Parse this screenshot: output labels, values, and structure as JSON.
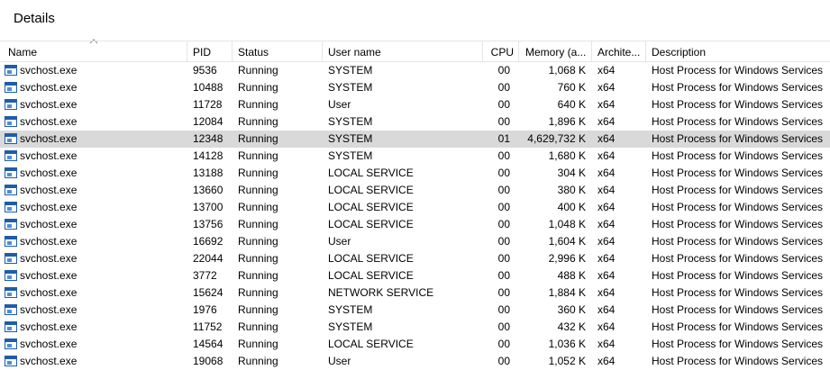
{
  "panel": {
    "title": "Details"
  },
  "columns": {
    "name": "Name",
    "pid": "PID",
    "status": "Status",
    "user": "User name",
    "cpu": "CPU",
    "memory": "Memory (a...",
    "arch": "Archite...",
    "description": "Description"
  },
  "sort": {
    "column": "Name",
    "direction": "ascending"
  },
  "icon": "process-window-icon",
  "selected_row_index": 4,
  "rows": [
    {
      "name": "svchost.exe",
      "pid": "9536",
      "status": "Running",
      "user": "SYSTEM",
      "cpu": "00",
      "memory": "1,068 K",
      "arch": "x64",
      "description": "Host Process for Windows Services"
    },
    {
      "name": "svchost.exe",
      "pid": "10488",
      "status": "Running",
      "user": "SYSTEM",
      "cpu": "00",
      "memory": "760 K",
      "arch": "x64",
      "description": "Host Process for Windows Services"
    },
    {
      "name": "svchost.exe",
      "pid": "11728",
      "status": "Running",
      "user": "User",
      "cpu": "00",
      "memory": "640 K",
      "arch": "x64",
      "description": "Host Process for Windows Services"
    },
    {
      "name": "svchost.exe",
      "pid": "12084",
      "status": "Running",
      "user": "SYSTEM",
      "cpu": "00",
      "memory": "1,896 K",
      "arch": "x64",
      "description": "Host Process for Windows Services"
    },
    {
      "name": "svchost.exe",
      "pid": "12348",
      "status": "Running",
      "user": "SYSTEM",
      "cpu": "01",
      "memory": "4,629,732 K",
      "arch": "x64",
      "description": "Host Process for Windows Services"
    },
    {
      "name": "svchost.exe",
      "pid": "14128",
      "status": "Running",
      "user": "SYSTEM",
      "cpu": "00",
      "memory": "1,680 K",
      "arch": "x64",
      "description": "Host Process for Windows Services"
    },
    {
      "name": "svchost.exe",
      "pid": "13188",
      "status": "Running",
      "user": "LOCAL SERVICE",
      "cpu": "00",
      "memory": "304 K",
      "arch": "x64",
      "description": "Host Process for Windows Services"
    },
    {
      "name": "svchost.exe",
      "pid": "13660",
      "status": "Running",
      "user": "LOCAL SERVICE",
      "cpu": "00",
      "memory": "380 K",
      "arch": "x64",
      "description": "Host Process for Windows Services"
    },
    {
      "name": "svchost.exe",
      "pid": "13700",
      "status": "Running",
      "user": "LOCAL SERVICE",
      "cpu": "00",
      "memory": "400 K",
      "arch": "x64",
      "description": "Host Process for Windows Services"
    },
    {
      "name": "svchost.exe",
      "pid": "13756",
      "status": "Running",
      "user": "LOCAL SERVICE",
      "cpu": "00",
      "memory": "1,048 K",
      "arch": "x64",
      "description": "Host Process for Windows Services"
    },
    {
      "name": "svchost.exe",
      "pid": "16692",
      "status": "Running",
      "user": "User",
      "cpu": "00",
      "memory": "1,604 K",
      "arch": "x64",
      "description": "Host Process for Windows Services"
    },
    {
      "name": "svchost.exe",
      "pid": "22044",
      "status": "Running",
      "user": "LOCAL SERVICE",
      "cpu": "00",
      "memory": "2,996 K",
      "arch": "x64",
      "description": "Host Process for Windows Services"
    },
    {
      "name": "svchost.exe",
      "pid": "3772",
      "status": "Running",
      "user": "LOCAL SERVICE",
      "cpu": "00",
      "memory": "488 K",
      "arch": "x64",
      "description": "Host Process for Windows Services"
    },
    {
      "name": "svchost.exe",
      "pid": "15624",
      "status": "Running",
      "user": "NETWORK SERVICE",
      "cpu": "00",
      "memory": "1,884 K",
      "arch": "x64",
      "description": "Host Process for Windows Services"
    },
    {
      "name": "svchost.exe",
      "pid": "1976",
      "status": "Running",
      "user": "SYSTEM",
      "cpu": "00",
      "memory": "360 K",
      "arch": "x64",
      "description": "Host Process for Windows Services"
    },
    {
      "name": "svchost.exe",
      "pid": "11752",
      "status": "Running",
      "user": "SYSTEM",
      "cpu": "00",
      "memory": "432 K",
      "arch": "x64",
      "description": "Host Process for Windows Services"
    },
    {
      "name": "svchost.exe",
      "pid": "14564",
      "status": "Running",
      "user": "LOCAL SERVICE",
      "cpu": "00",
      "memory": "1,036 K",
      "arch": "x64",
      "description": "Host Process for Windows Services"
    },
    {
      "name": "svchost.exe",
      "pid": "19068",
      "status": "Running",
      "user": "User",
      "cpu": "00",
      "memory": "1,052 K",
      "arch": "x64",
      "description": "Host Process for Windows Services"
    }
  ]
}
